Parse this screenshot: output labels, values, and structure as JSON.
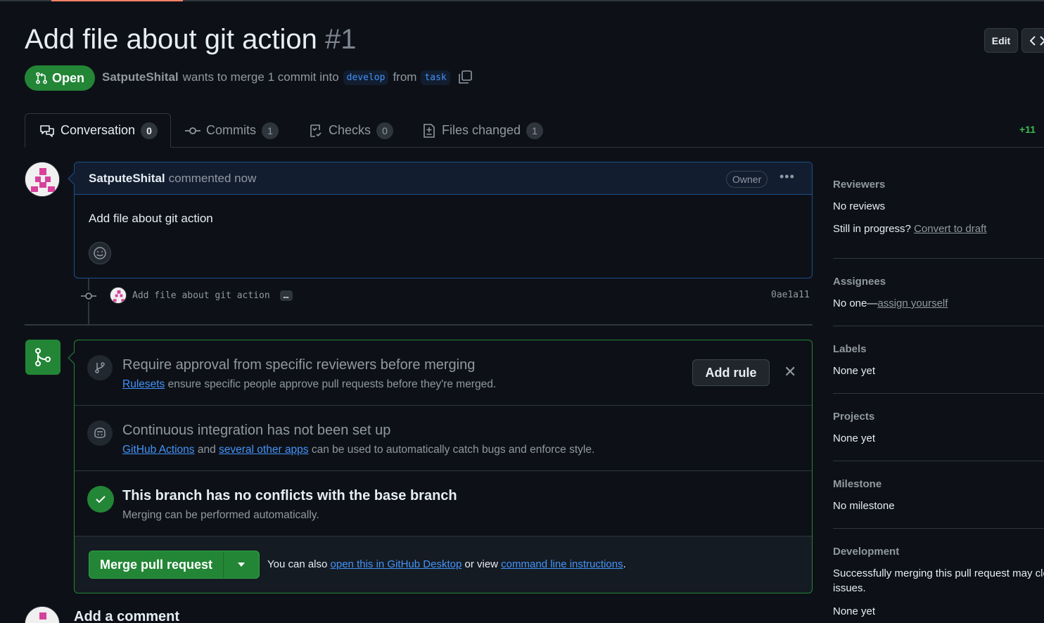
{
  "header": {
    "title": "Add file about git action",
    "number": "#1",
    "edit_label": "Edit",
    "code_label": "<>",
    "state": "Open",
    "author": "SatputeShital",
    "merge_text_1": "wants to merge 1 commit into",
    "base_branch": "develop",
    "merge_text_2": "from",
    "head_branch": "task"
  },
  "tabs": [
    {
      "label": "Conversation",
      "count": "0",
      "icon": "comment-discussion-icon"
    },
    {
      "label": "Commits",
      "count": "1",
      "icon": "commit-icon"
    },
    {
      "label": "Checks",
      "count": "0",
      "icon": "checklist-icon"
    },
    {
      "label": "Files changed",
      "count": "1",
      "icon": "file-diff-icon"
    }
  ],
  "diffstat": "+11",
  "comment": {
    "author": "SatputeShital",
    "time": "commented now",
    "badge": "Owner",
    "body": "Add file about git action"
  },
  "commit": {
    "message": "Add file about git action",
    "ellipsis": "…",
    "sha": "0ae1a11"
  },
  "merge_box": {
    "rules_title": "Require approval from specific reviewers before merging",
    "rules_link": "Rulesets",
    "rules_desc": "ensure specific people approve pull requests before they're merged.",
    "add_rule_label": "Add rule",
    "ci_title": "Continuous integration has not been set up",
    "ci_link_1": "GitHub Actions",
    "ci_and": "and",
    "ci_link_2": "several other apps",
    "ci_desc": "can be used to automatically catch bugs and enforce style.",
    "conflict_title": "This branch has no conflicts with the base branch",
    "conflict_desc": "Merging can be performed automatically.",
    "merge_button_label": "Merge pull request",
    "also_text_1": "You can also",
    "also_link_1": "open this in GitHub Desktop",
    "also_text_2": "or view",
    "also_link_2": "command line instructions",
    "also_text_3": "."
  },
  "add_comment_heading": "Add a comment",
  "sidebar": {
    "reviewers": {
      "heading": "Reviewers",
      "value": "No reviews",
      "draft_prefix": "Still in progress?",
      "draft_link": "Convert to draft"
    },
    "assignees": {
      "heading": "Assignees",
      "value": "No one—",
      "link": "assign yourself"
    },
    "labels": {
      "heading": "Labels",
      "value": "None yet"
    },
    "projects": {
      "heading": "Projects",
      "value": "None yet"
    },
    "milestone": {
      "heading": "Milestone",
      "value": "No milestone"
    },
    "development": {
      "heading": "Development",
      "desc_1": "Successfully merging this pull request may close these",
      "desc_2": "issues.",
      "value": "None yet"
    }
  },
  "colors": {
    "background": "#0d1117",
    "open_green": "#238636",
    "link_blue": "#4493f8",
    "muted": "#9198a1"
  }
}
